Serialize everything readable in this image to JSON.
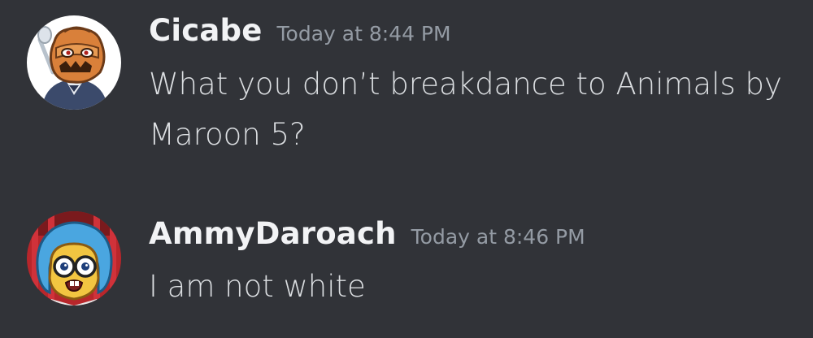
{
  "messages": [
    {
      "username": "Cicabe",
      "timestamp": "Today at 8:44 PM",
      "content": "What you don’t breakdance to Animals by Maroon 5?",
      "avatar_icon": "pumpkin-head-character-avatar"
    },
    {
      "username": "AmmyDaroach",
      "timestamp": "Today at 8:46 PM",
      "content": "I am not white",
      "avatar_icon": "blue-hair-character-avatar"
    }
  ],
  "colors": {
    "background": "#313338",
    "username": "#f2f3f5",
    "timestamp": "#949ba4",
    "content": "#dbdee1"
  }
}
